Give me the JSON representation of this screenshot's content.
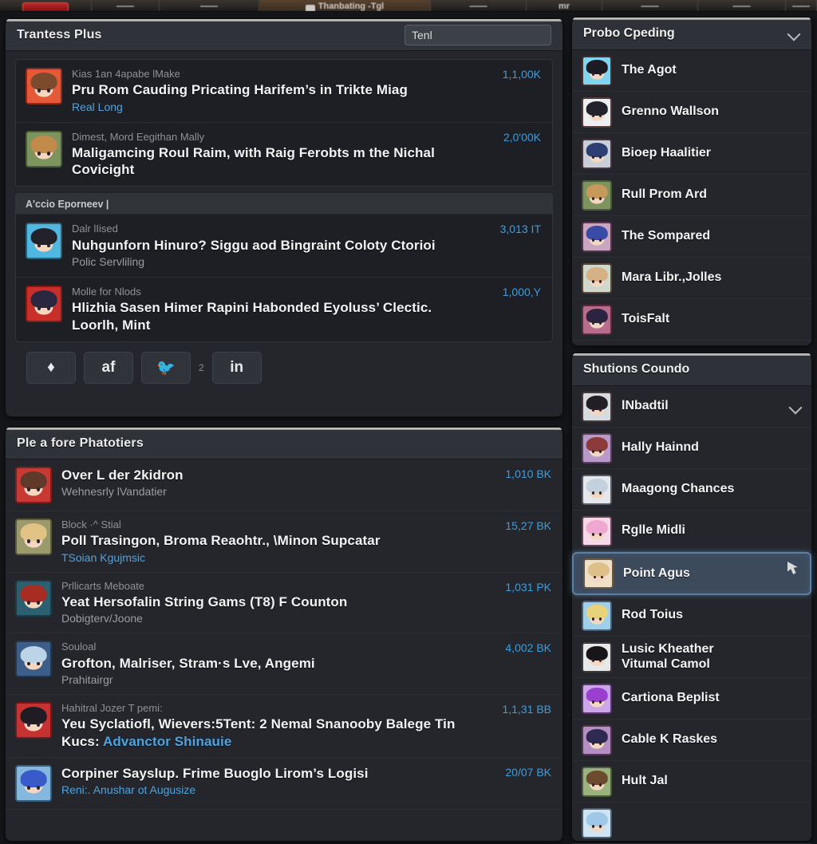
{
  "topbar": {
    "items": [
      {
        "label": "",
        "type": "red-chip"
      },
      {
        "label": "",
        "type": "text"
      },
      {
        "label": "",
        "type": "text"
      },
      {
        "label": "Thanbating -Tgl",
        "type": "text",
        "active": true
      },
      {
        "label": "",
        "type": "text"
      },
      {
        "label": "mr",
        "type": "text"
      },
      {
        "label": "",
        "type": "text"
      },
      {
        "label": "",
        "type": "text"
      },
      {
        "label": "",
        "type": "text"
      }
    ]
  },
  "feed_panel": {
    "title": "Trantess Plus",
    "search": {
      "value": "Tenl",
      "placeholder": "Tenl"
    },
    "cards": [
      {
        "subhead": null,
        "rows": [
          {
            "kicker": "Kias 1an 4apabe lMake",
            "headline": "Pru Rom Cauding Pricating Harifem’s in Trikte Miag",
            "subline": "Real Long",
            "subline_style": "link",
            "count": "1,1,00K",
            "avatar": {
              "hair": "#7a4a2e",
              "bg": "#e05a3c",
              "border": "#8a2b1e"
            }
          },
          {
            "kicker": "Dimest, Mord Eegithan Mally",
            "headline": "Maligamcing Roul Raim, with Raig Ferobts m the Nichal Covicight",
            "subline": null,
            "subline_style": "plain",
            "count": "2,0'00K",
            "avatar": {
              "hair": "#c08a4e",
              "bg": "#7f9460",
              "border": "#4c5c3a"
            }
          }
        ]
      },
      {
        "subhead": "A'ccio Eporneev |",
        "rows": [
          {
            "kicker": "Dalr lIised",
            "headline": "Nuhgunforn Hinuro? Siggu aod Bingraint Coloty Ctorioi",
            "subline": "Polic Servliling",
            "subline_style": "plain",
            "count": "3,013 IT",
            "avatar": {
              "hair": "#23222a",
              "bg": "#54b7dd",
              "border": "#2c5f73"
            }
          },
          {
            "kicker": "Molle for Nlods",
            "headline": "Hlizhia Sasen Himer Rapini Habonded Eyoluss’ Clectic. Loorlh, Mint",
            "subline": null,
            "subline_style": "plain",
            "count": "1,000,Y",
            "avatar": {
              "hair": "#2b2740",
              "bg": "#c2302c",
              "border": "#7b1c18"
            }
          }
        ]
      }
    ],
    "share": {
      "buttons": [
        {
          "name": "share-generic-icon",
          "glyph": "♦"
        },
        {
          "name": "facebook-icon",
          "glyph": "af"
        },
        {
          "name": "twitter-icon",
          "glyph": "🐦"
        },
        {
          "name": "linkedin-icon",
          "glyph": "in"
        }
      ],
      "twitter_count": "2"
    }
  },
  "list_panel": {
    "title": "Ple a fore Phatotiers",
    "rows": [
      {
        "kicker": null,
        "headline": "Over L der 2kidron",
        "subline": "Wehnesrly lVandatier",
        "subline_style": "plain",
        "count": "1,010 BK",
        "avatar": {
          "hair": "#5e3a2b",
          "bg": "#c43a36",
          "border": "#7a201e"
        }
      },
      {
        "kicker": "Block ·^ Stial",
        "headline": "Poll Trasingon, Broma Reaohtr., \\Minon Supcatar",
        "subline": "TSoian Kgujmsic",
        "subline_style": "link",
        "count": "15,27 BK",
        "avatar": {
          "hair": "#e0c389",
          "bg": "#9a9a6e",
          "border": "#5b5a3c"
        }
      },
      {
        "kicker": "Prllicarts Meboate",
        "headline": "Yeat Hersofalin String Gams (T8) F Counton",
        "subline": "Dobigterv/Joone",
        "subline_style": "plain",
        "count": "1,031 PK",
        "avatar": {
          "hair": "#a32d23",
          "bg": "#2e5f6e",
          "border": "#1d3b45"
        }
      },
      {
        "kicker": "Souloal",
        "headline": "Grofton, Malriser, Stram·s Lve, Angemi",
        "subline": "Prahitairgr",
        "subline_style": "plain",
        "count": "4,002 BK",
        "avatar": {
          "hair": "#bcd4e6",
          "bg": "#3d5e86",
          "border": "#24384f"
        }
      },
      {
        "kicker": "Hahitral Jozer T pemi:",
        "headline": "Yeu Syclatiofl, Wievers:5Tent: 2 Nemal Snanooby Balege Tin Kucs:",
        "headline_link": "Advanctor Shinauie",
        "subline": null,
        "subline_style": "plain",
        "count": "1,1,31 BB",
        "avatar": {
          "hair": "#1f1c24",
          "bg": "#c03333",
          "border": "#6d1c1c"
        }
      },
      {
        "kicker": null,
        "headline": "Corpiner Sayslup. Frime Buoglo Lirom’s Logisi",
        "subline": "Reni:. Anushar ot Augusize",
        "subline_style": "link",
        "count": "20/07 BK",
        "avatar": {
          "hair": "#3b5bc4",
          "bg": "#86b8dd",
          "border": "#3b5f7c"
        }
      }
    ]
  },
  "right_top_panel": {
    "title": "Probo Cpeding",
    "collapse_icon": "chevron-down-icon",
    "items": [
      {
        "name": "The Agot",
        "avatar": {
          "hair": "#1c1a22",
          "bg": "#7fd4ef",
          "border": "#4a2f2f"
        }
      },
      {
        "name": "Grenno Wallson",
        "avatar": {
          "hair": "#23212c",
          "bg": "#eceff2",
          "border": "#5a3b3b"
        }
      },
      {
        "name": "Bioep Haalitier",
        "avatar": {
          "hair": "#2d3f72",
          "bg": "#c9cfd8",
          "border": "#4a3440"
        }
      },
      {
        "name": "Rull Prom Ard",
        "avatar": {
          "hair": "#c79a5c",
          "bg": "#7d9461",
          "border": "#4b5b3a"
        }
      },
      {
        "name": "The Sompared",
        "avatar": {
          "hair": "#3a4ba6",
          "bg": "#c9a6c0",
          "border": "#5b3550"
        }
      },
      {
        "name": "Mara Libr.,Jolles",
        "avatar": {
          "hair": "#d6b183",
          "bg": "#cfd8cd",
          "border": "#5a4a3a"
        }
      },
      {
        "name": "ToisFalt",
        "avatar": {
          "hair": "#2b2340",
          "bg": "#b86c8c",
          "border": "#5c2b3c"
        }
      }
    ]
  },
  "right_bottom_panel": {
    "title": "Shutions Coundo",
    "items": [
      {
        "name": "lNbadtil",
        "chevron": true,
        "selected": false,
        "avatar": {
          "hair": "#231f26",
          "bg": "#d7dbe0",
          "border": "#4a3b3b"
        }
      },
      {
        "name": "Hally Hainnd",
        "chevron": false,
        "selected": false,
        "avatar": {
          "hair": "#8d3b3a",
          "bg": "#b79ac9",
          "border": "#5b3e5c"
        }
      },
      {
        "name": "Maagong Chances",
        "chevron": false,
        "selected": false,
        "avatar": {
          "hair": "#c3d0dd",
          "bg": "#e4e8ec",
          "border": "#5a5a62"
        }
      },
      {
        "name": "Rglle Midli",
        "chevron": false,
        "selected": false,
        "avatar": {
          "hair": "#f0a8d0",
          "bg": "#f6d9e8",
          "border": "#6b4357"
        }
      },
      {
        "name": "Point Agus",
        "chevron": false,
        "selected": true,
        "cursor_icon": "mouse-cursor-icon",
        "avatar": {
          "hair": "#e0c089",
          "bg": "#efe0c8",
          "border": "#6a5840"
        }
      },
      {
        "name": "Rod Toius",
        "chevron": false,
        "selected": false,
        "avatar": {
          "hair": "#e8d27a",
          "bg": "#9fd0ea",
          "border": "#49607a"
        }
      },
      {
        "name": "Lusic Kheather",
        "name2": "Vitumal Camol",
        "chevron": false,
        "selected": false,
        "avatar": {
          "hair": "#171519",
          "bg": "#e6e8ea",
          "border": "#3e3a3e"
        }
      },
      {
        "name": "Cartiona Beplist",
        "chevron": false,
        "selected": false,
        "avatar": {
          "hair": "#9b3fd1",
          "bg": "#cba6e8",
          "border": "#5b3570"
        }
      },
      {
        "name": "Cable K Raskes",
        "chevron": false,
        "selected": false,
        "avatar": {
          "hair": "#2e2a52",
          "bg": "#b58fc4",
          "border": "#52354f"
        }
      },
      {
        "name": "Hult Jal",
        "chevron": false,
        "selected": false,
        "avatar": {
          "hair": "#6b4a2e",
          "bg": "#9ab27c",
          "border": "#4c5b3c"
        }
      },
      {
        "name": "",
        "chevron": false,
        "selected": false,
        "avatar": {
          "hair": "#9fc8e8",
          "bg": "#cfe4f2",
          "border": "#4a5f72"
        }
      }
    ]
  },
  "colors": {
    "app_background": "#141518",
    "panel_background": "#24262b",
    "panel_header": "#2f3238",
    "card_background": "#1d1f24",
    "accent_blue": "#3d9ede",
    "headline_text": "#f2f3f4",
    "muted_text": "#8e9196",
    "selection_blue": "#3c4a5c",
    "selection_border": "#5d7fa3"
  }
}
